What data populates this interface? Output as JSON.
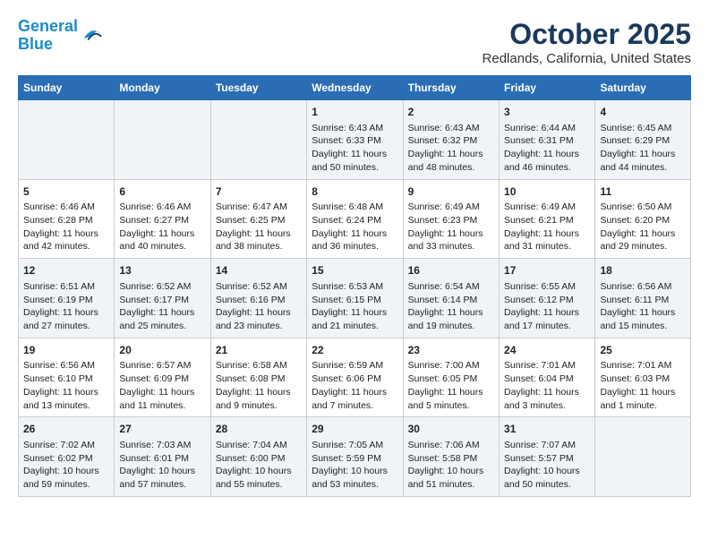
{
  "logo": {
    "line1": "General",
    "line2": "Blue"
  },
  "title": "October 2025",
  "subtitle": "Redlands, California, United States",
  "days_header": [
    "Sunday",
    "Monday",
    "Tuesday",
    "Wednesday",
    "Thursday",
    "Friday",
    "Saturday"
  ],
  "weeks": [
    [
      {
        "day": "",
        "info": ""
      },
      {
        "day": "",
        "info": ""
      },
      {
        "day": "",
        "info": ""
      },
      {
        "day": "1",
        "info": "Sunrise: 6:43 AM\nSunset: 6:33 PM\nDaylight: 11 hours\nand 50 minutes."
      },
      {
        "day": "2",
        "info": "Sunrise: 6:43 AM\nSunset: 6:32 PM\nDaylight: 11 hours\nand 48 minutes."
      },
      {
        "day": "3",
        "info": "Sunrise: 6:44 AM\nSunset: 6:31 PM\nDaylight: 11 hours\nand 46 minutes."
      },
      {
        "day": "4",
        "info": "Sunrise: 6:45 AM\nSunset: 6:29 PM\nDaylight: 11 hours\nand 44 minutes."
      }
    ],
    [
      {
        "day": "5",
        "info": "Sunrise: 6:46 AM\nSunset: 6:28 PM\nDaylight: 11 hours\nand 42 minutes."
      },
      {
        "day": "6",
        "info": "Sunrise: 6:46 AM\nSunset: 6:27 PM\nDaylight: 11 hours\nand 40 minutes."
      },
      {
        "day": "7",
        "info": "Sunrise: 6:47 AM\nSunset: 6:25 PM\nDaylight: 11 hours\nand 38 minutes."
      },
      {
        "day": "8",
        "info": "Sunrise: 6:48 AM\nSunset: 6:24 PM\nDaylight: 11 hours\nand 36 minutes."
      },
      {
        "day": "9",
        "info": "Sunrise: 6:49 AM\nSunset: 6:23 PM\nDaylight: 11 hours\nand 33 minutes."
      },
      {
        "day": "10",
        "info": "Sunrise: 6:49 AM\nSunset: 6:21 PM\nDaylight: 11 hours\nand 31 minutes."
      },
      {
        "day": "11",
        "info": "Sunrise: 6:50 AM\nSunset: 6:20 PM\nDaylight: 11 hours\nand 29 minutes."
      }
    ],
    [
      {
        "day": "12",
        "info": "Sunrise: 6:51 AM\nSunset: 6:19 PM\nDaylight: 11 hours\nand 27 minutes."
      },
      {
        "day": "13",
        "info": "Sunrise: 6:52 AM\nSunset: 6:17 PM\nDaylight: 11 hours\nand 25 minutes."
      },
      {
        "day": "14",
        "info": "Sunrise: 6:52 AM\nSunset: 6:16 PM\nDaylight: 11 hours\nand 23 minutes."
      },
      {
        "day": "15",
        "info": "Sunrise: 6:53 AM\nSunset: 6:15 PM\nDaylight: 11 hours\nand 21 minutes."
      },
      {
        "day": "16",
        "info": "Sunrise: 6:54 AM\nSunset: 6:14 PM\nDaylight: 11 hours\nand 19 minutes."
      },
      {
        "day": "17",
        "info": "Sunrise: 6:55 AM\nSunset: 6:12 PM\nDaylight: 11 hours\nand 17 minutes."
      },
      {
        "day": "18",
        "info": "Sunrise: 6:56 AM\nSunset: 6:11 PM\nDaylight: 11 hours\nand 15 minutes."
      }
    ],
    [
      {
        "day": "19",
        "info": "Sunrise: 6:56 AM\nSunset: 6:10 PM\nDaylight: 11 hours\nand 13 minutes."
      },
      {
        "day": "20",
        "info": "Sunrise: 6:57 AM\nSunset: 6:09 PM\nDaylight: 11 hours\nand 11 minutes."
      },
      {
        "day": "21",
        "info": "Sunrise: 6:58 AM\nSunset: 6:08 PM\nDaylight: 11 hours\nand 9 minutes."
      },
      {
        "day": "22",
        "info": "Sunrise: 6:59 AM\nSunset: 6:06 PM\nDaylight: 11 hours\nand 7 minutes."
      },
      {
        "day": "23",
        "info": "Sunrise: 7:00 AM\nSunset: 6:05 PM\nDaylight: 11 hours\nand 5 minutes."
      },
      {
        "day": "24",
        "info": "Sunrise: 7:01 AM\nSunset: 6:04 PM\nDaylight: 11 hours\nand 3 minutes."
      },
      {
        "day": "25",
        "info": "Sunrise: 7:01 AM\nSunset: 6:03 PM\nDaylight: 11 hours\nand 1 minute."
      }
    ],
    [
      {
        "day": "26",
        "info": "Sunrise: 7:02 AM\nSunset: 6:02 PM\nDaylight: 10 hours\nand 59 minutes."
      },
      {
        "day": "27",
        "info": "Sunrise: 7:03 AM\nSunset: 6:01 PM\nDaylight: 10 hours\nand 57 minutes."
      },
      {
        "day": "28",
        "info": "Sunrise: 7:04 AM\nSunset: 6:00 PM\nDaylight: 10 hours\nand 55 minutes."
      },
      {
        "day": "29",
        "info": "Sunrise: 7:05 AM\nSunset: 5:59 PM\nDaylight: 10 hours\nand 53 minutes."
      },
      {
        "day": "30",
        "info": "Sunrise: 7:06 AM\nSunset: 5:58 PM\nDaylight: 10 hours\nand 51 minutes."
      },
      {
        "day": "31",
        "info": "Sunrise: 7:07 AM\nSunset: 5:57 PM\nDaylight: 10 hours\nand 50 minutes."
      },
      {
        "day": "",
        "info": ""
      }
    ]
  ]
}
